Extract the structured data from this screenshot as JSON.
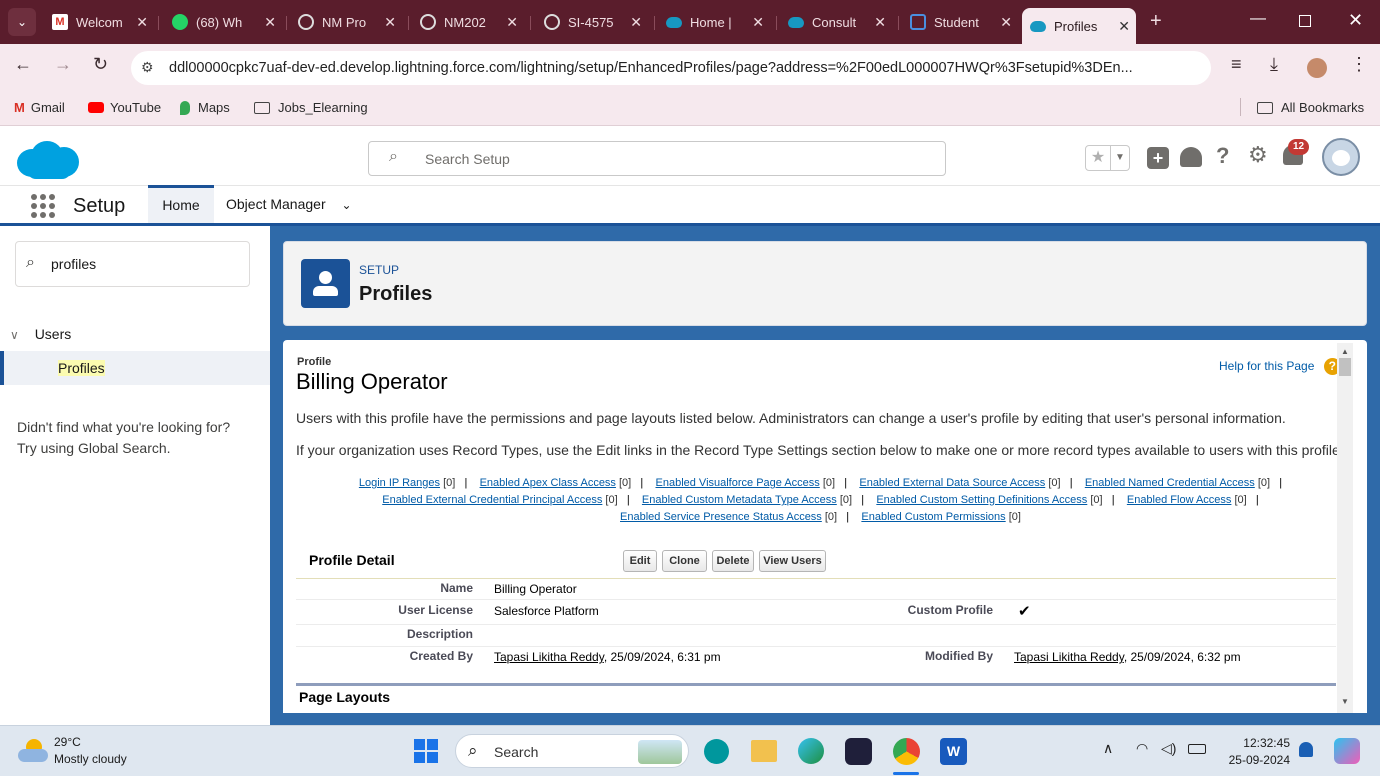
{
  "browser": {
    "tabs": [
      {
        "label": "Welcom",
        "icon": "gmail-icon"
      },
      {
        "label": "(68) Wh",
        "icon": "whatsapp-icon"
      },
      {
        "label": "NM Pro",
        "icon": "globe-icon"
      },
      {
        "label": "NM202",
        "icon": "globe-icon"
      },
      {
        "label": "SI-4575",
        "icon": "globe-icon"
      },
      {
        "label": "Home |",
        "icon": "salesforce-icon"
      },
      {
        "label": "Consult",
        "icon": "salesforce-icon"
      },
      {
        "label": "Student",
        "icon": "square-icon"
      },
      {
        "label": "Profiles",
        "icon": "salesforce-icon"
      }
    ],
    "url": "ddl00000cpkc7uaf-dev-ed.develop.lightning.force.com/lightning/setup/EnhancedProfiles/page?address=%2F00edL000007HWQr%3Fsetupid%3DEn...",
    "bookmarks": [
      "Gmail",
      "YouTube",
      "Maps",
      "Jobs_Elearning"
    ],
    "all_bookmarks": "All Bookmarks"
  },
  "sf": {
    "search_placeholder": "Search Setup",
    "notification_count": "12",
    "app_name": "Setup",
    "nav_tabs": [
      "Home",
      "Object Manager"
    ]
  },
  "sidebar": {
    "search_value": "profiles",
    "group": "Users",
    "item": "Profiles",
    "help_line1": "Didn't find what you're looking for?",
    "help_line2": "Try using Global Search."
  },
  "header": {
    "breadcrumb": "SETUP",
    "title": "Profiles"
  },
  "profile": {
    "type_label": "Profile",
    "name": "Billing Operator",
    "help_link": "Help for this Page",
    "desc1": "Users with this profile have the permissions and page layouts listed below. Administrators can change a user's profile by editing that user's personal information.",
    "desc2": "If your organization uses Record Types, use the Edit links in the Record Type Settings section below to make one or more record types available to users with this profile.",
    "links_row1": [
      {
        "label": "Login IP Ranges",
        "count": "[0]"
      },
      {
        "label": "Enabled Apex Class Access",
        "count": "[0]"
      },
      {
        "label": "Enabled Visualforce Page Access",
        "count": "[0]"
      },
      {
        "label": "Enabled External Data Source Access",
        "count": "[0]"
      },
      {
        "label": "Enabled Named Credential Access",
        "count": "[0]"
      }
    ],
    "links_row2": [
      {
        "label": "Enabled External Credential Principal Access",
        "count": "[0]"
      },
      {
        "label": "Enabled Custom Metadata Type Access",
        "count": "[0]"
      },
      {
        "label": "Enabled Custom Setting Definitions Access",
        "count": "[0]"
      },
      {
        "label": "Enabled Flow Access",
        "count": "[0]"
      }
    ],
    "links_row3": [
      {
        "label": "Enabled Service Presence Status Access",
        "count": "[0]"
      },
      {
        "label": "Enabled Custom Permissions",
        "count": "[0]"
      }
    ],
    "detail_title": "Profile Detail",
    "buttons": [
      "Edit",
      "Clone",
      "Delete",
      "View Users"
    ],
    "fields": {
      "name_label": "Name",
      "name_value": "Billing Operator",
      "license_label": "User License",
      "license_value": "Salesforce Platform",
      "custom_label": "Custom Profile",
      "custom_value": "✔",
      "description_label": "Description",
      "created_label": "Created By",
      "created_user": "Tapasi Likitha Reddy",
      "created_date": ", 25/09/2024, 6:31 pm",
      "modified_label": "Modified By",
      "modified_user": "Tapasi Likitha Reddy",
      "modified_date": ", 25/09/2024, 6:32 pm"
    },
    "page_layouts": "Page Layouts"
  },
  "taskbar": {
    "temp": "29°C",
    "weather": "Mostly cloudy",
    "search": "Search",
    "time": "12:32:45",
    "date": "25-09-2024"
  }
}
